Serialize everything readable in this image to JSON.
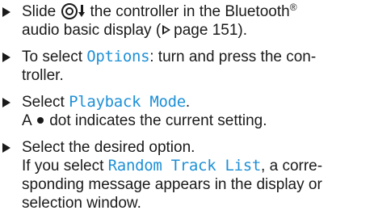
{
  "colors": {
    "ui_text": "#1e90d6",
    "body_text": "#1a1a1a"
  },
  "icons": {
    "step_marker": "right-triangle-bullet",
    "controller": "controller-knob-icon",
    "slide_down": "down-arrow-icon",
    "page_reference": "page-reference-triangle-icon",
    "selection_dot": "filled-dot-icon"
  },
  "steps": [
    {
      "s1_a": "Slide",
      "s1_b": "the controller in the Bluetooth",
      "s1_sup": "®",
      "s1_c": "audio basic display (",
      "s1_d": "page 151)."
    },
    {
      "s2_a": "To select",
      "s2_ui": "Options",
      "s2_b": ": turn and press the con-",
      "s2_c": "troller."
    },
    {
      "s3_a": "Select",
      "s3_ui": "Playback Mode",
      "s3_b": ".",
      "s3_c": "A",
      "s3_d": "dot indicates the current setting."
    },
    {
      "s4_a": "Select the desired option.",
      "s4_b": "If you select",
      "s4_ui": "Random Track List",
      "s4_c": ", a corre-",
      "s4_d": "sponding message appears in the display or",
      "s4_e": "selection window."
    }
  ]
}
